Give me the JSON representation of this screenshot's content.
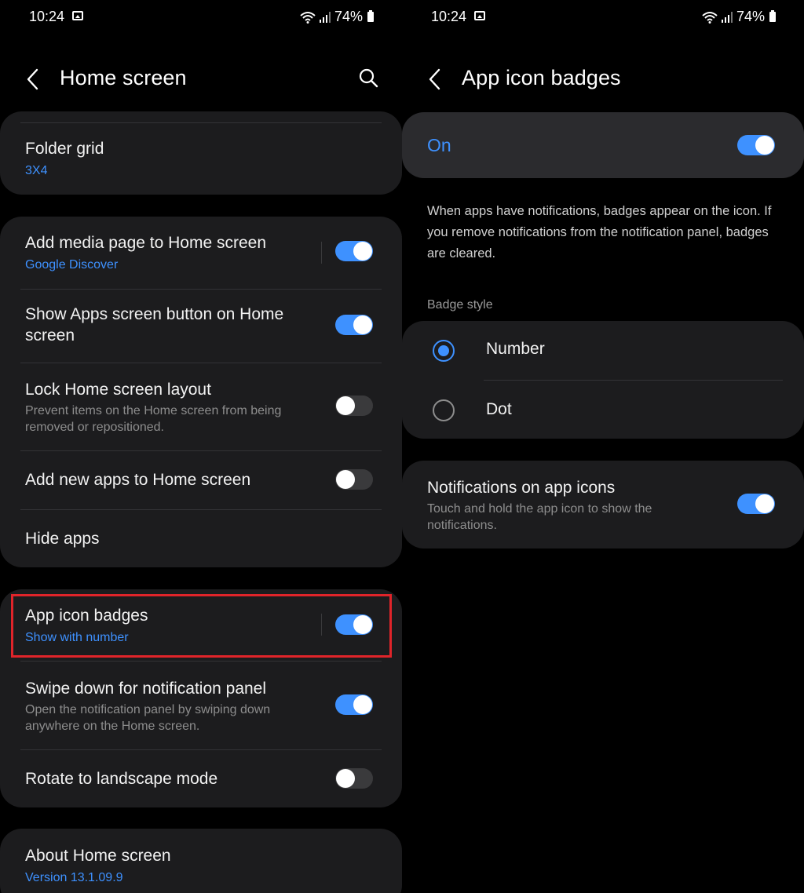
{
  "left": {
    "status": {
      "time": "10:24",
      "battery": "74%"
    },
    "header": {
      "title": "Home screen"
    },
    "items": {
      "folder_grid": {
        "title": "Folder grid",
        "value": "3X4"
      },
      "media_page": {
        "title": "Add media page to Home screen",
        "sub": "Google Discover",
        "on": true
      },
      "apps_button": {
        "title_line1": "Show Apps screen button on Home",
        "title_line2": "screen",
        "on": true
      },
      "lock_layout": {
        "title": "Lock Home screen layout",
        "sub_line1": "Prevent items on the Home screen from being",
        "sub_line2": "removed or repositioned.",
        "on": false
      },
      "add_new_apps": {
        "title": "Add new apps to Home screen",
        "on": false
      },
      "hide_apps": {
        "title": "Hide apps"
      },
      "badges": {
        "title": "App icon badges",
        "sub": "Show with number",
        "on": true
      },
      "swipe_down": {
        "title": "Swipe down for notification panel",
        "sub_line1": "Open the notification panel by swiping down",
        "sub_line2": "anywhere on the Home screen.",
        "on": true
      },
      "rotate": {
        "title": "Rotate to landscape mode",
        "on": false
      },
      "about": {
        "title": "About Home screen",
        "version": "Version 13.1.09.9"
      }
    }
  },
  "right": {
    "status": {
      "time": "10:24",
      "battery": "74%"
    },
    "header": {
      "title": "App icon badges"
    },
    "master": {
      "label": "On",
      "on": true
    },
    "description": "When apps have notifications, badges appear on the icon. If you remove notifications from the notification panel, badges are cleared.",
    "badge_style": {
      "label": "Badge style",
      "options": [
        {
          "label": "Number",
          "selected": true
        },
        {
          "label": "Dot",
          "selected": false
        }
      ]
    },
    "notif_icons": {
      "title": "Notifications on app icons",
      "sub_line1": "Touch and hold the app icon to show the",
      "sub_line2": "notifications.",
      "on": true
    }
  },
  "colors": {
    "accent": "#3e91ff",
    "card": "#1c1c1e",
    "highlight": "#e0242a"
  },
  "icons": [
    "back-icon",
    "search-icon",
    "wifi-icon",
    "signal-icon",
    "battery-icon",
    "image-icon"
  ]
}
